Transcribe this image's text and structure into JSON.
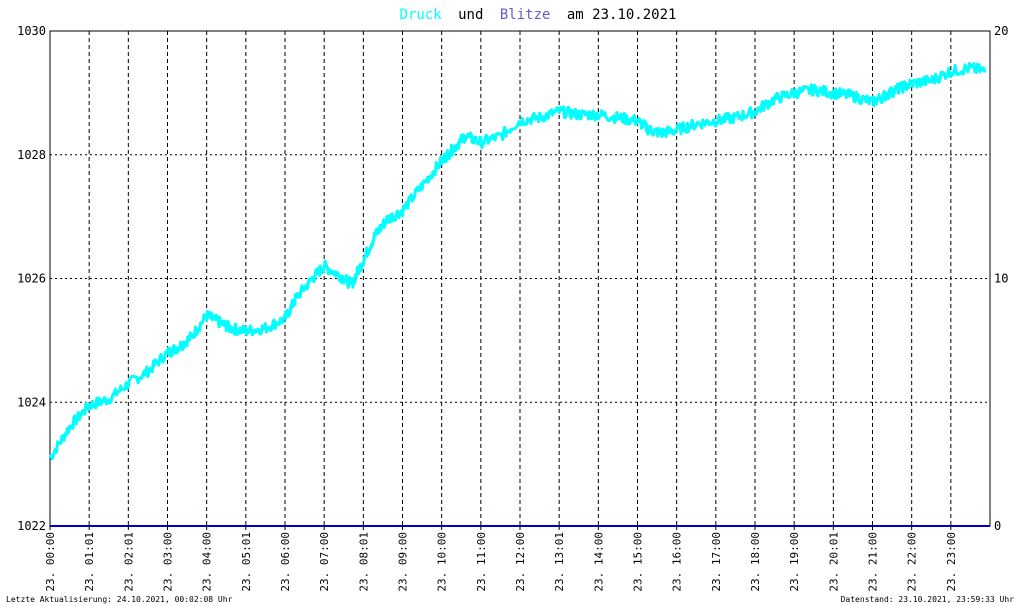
{
  "title": {
    "part1": "Druck",
    "part2": "und",
    "part3": "Blitze",
    "part4": "am 23.10.2021"
  },
  "footer": {
    "left": "Letzte Aktualisierung: 24.10.2021, 00:02:08 Uhr",
    "right": "Datenstand: 23.10.2021, 23:59:33 Uhr"
  },
  "colors": {
    "druck": "#00ffff",
    "blitze": "#0000cc",
    "title_blitze": "#6a5acd",
    "grid": "#000000",
    "axis_text": "#000000"
  },
  "chart_data": {
    "type": "line",
    "title": "Druck und Blitze am 23.10.2021",
    "xlim": [
      0,
      24
    ],
    "ylim_left": [
      1022,
      1030
    ],
    "ylim_right": [
      0,
      20
    ],
    "left_ticks": [
      "1022",
      "1024",
      "1026",
      "1028",
      "1030"
    ],
    "right_ticks": [
      "0",
      "10",
      "20"
    ],
    "x_tick_labels": [
      "23. 00:00",
      "23. 01:01",
      "23. 02:01",
      "23. 03:00",
      "23. 04:00",
      "23. 05:01",
      "23. 06:00",
      "23. 07:00",
      "23. 08:01",
      "23. 09:00",
      "23. 10:00",
      "23. 11:00",
      "23. 12:00",
      "23. 13:01",
      "23. 14:00",
      "23. 15:00",
      "23. 16:00",
      "23. 17:00",
      "23. 18:00",
      "23. 19:00",
      "23. 20:01",
      "23. 21:00",
      "23. 22:00",
      "23. 23:00"
    ],
    "x_tick_hours": [
      0,
      1,
      2,
      3,
      4,
      5,
      6,
      7,
      8,
      9,
      10,
      11,
      12,
      13,
      14,
      15,
      16,
      17,
      18,
      19,
      20,
      21,
      22,
      23
    ],
    "grid": true,
    "series": [
      {
        "name": "Druck",
        "axis": "left",
        "x": [
          0,
          0.5,
          1,
          1.5,
          2,
          2.5,
          3,
          3.3,
          3.6,
          4,
          4.3,
          4.6,
          5,
          5.5,
          6,
          6.3,
          6.7,
          7,
          7.4,
          7.7,
          8,
          8.3,
          8.6,
          9,
          9.5,
          10,
          10.3,
          10.6,
          11,
          11.5,
          12,
          12.5,
          13,
          13.5,
          14,
          14.5,
          15,
          15.3,
          15.6,
          16,
          16.5,
          17,
          17.5,
          18,
          18.5,
          19,
          19.5,
          20,
          20.5,
          21,
          21.3,
          21.6,
          22,
          22.5,
          23,
          23.5,
          23.9
        ],
        "y": [
          1023.1,
          1023.6,
          1023.95,
          1024.05,
          1024.3,
          1024.5,
          1024.8,
          1024.9,
          1025.05,
          1025.4,
          1025.3,
          1025.2,
          1025.15,
          1025.2,
          1025.35,
          1025.7,
          1026.0,
          1026.2,
          1026.05,
          1025.9,
          1026.3,
          1026.7,
          1026.95,
          1027.1,
          1027.5,
          1027.9,
          1028.1,
          1028.3,
          1028.2,
          1028.3,
          1028.55,
          1028.6,
          1028.7,
          1028.65,
          1028.65,
          1028.6,
          1028.55,
          1028.4,
          1028.35,
          1028.4,
          1028.5,
          1028.55,
          1028.6,
          1028.7,
          1028.9,
          1029.0,
          1029.05,
          1029.0,
          1028.95,
          1028.85,
          1028.95,
          1029.05,
          1029.15,
          1029.2,
          1029.35,
          1029.4,
          1029.35
        ]
      },
      {
        "name": "Blitze",
        "axis": "right",
        "x": [
          0,
          24
        ],
        "y": [
          0,
          0
        ]
      }
    ]
  }
}
